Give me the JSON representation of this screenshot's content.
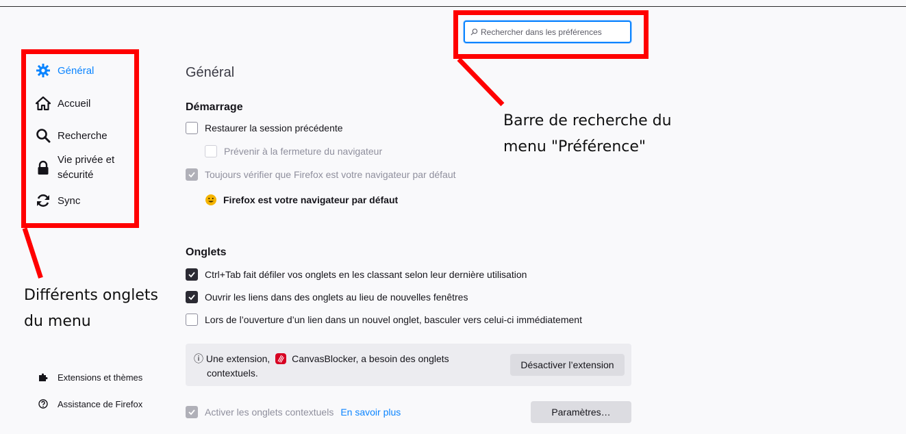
{
  "search": {
    "placeholder": "Rechercher dans les préférences"
  },
  "annotations": {
    "search_label_line1": "Barre de recherche du",
    "search_label_line2": "menu \"Préférence\"",
    "tabs_label_line1": "Différents onglets",
    "tabs_label_line2": "du menu",
    "color": "#ff0000"
  },
  "sidebar": {
    "items": [
      {
        "label": "Général",
        "icon": "gear-icon",
        "active": true
      },
      {
        "label": "Accueil",
        "icon": "home-icon"
      },
      {
        "label": "Recherche",
        "icon": "search-icon"
      },
      {
        "label_line1": "Vie privée et",
        "label_line2": "sécurité",
        "icon": "lock-icon"
      },
      {
        "label": "Sync",
        "icon": "sync-icon"
      }
    ],
    "footer": [
      {
        "label": "Extensions et thèmes",
        "icon": "puzzle-icon"
      },
      {
        "label": "Assistance de Firefox",
        "icon": "help-icon"
      }
    ]
  },
  "main": {
    "title": "Général",
    "startup": {
      "title": "Démarrage",
      "restore_session": "Restaurer la session précédente",
      "warn_on_close": "Prévenir à la fermeture du navigateur",
      "check_default": "Toujours vérifier que Firefox est votre navigateur par défaut",
      "default_status": "Firefox est votre navigateur par défaut"
    },
    "tabs": {
      "title": "Onglets",
      "ctrl_tab": "Ctrl+Tab fait défiler vos onglets en les classant selon leur dernière utilisation",
      "open_links": "Ouvrir les liens dans des onglets au lieu de nouvelles fenêtres",
      "switch_to_new": "Lors de l’ouverture d’un lien dans un nouvel onglet, basculer vers celui-ci immédiatement",
      "info_prefix": "ⓘ Une extension,",
      "info_ext_name": "CanvasBlocker, a besoin des onglets",
      "info_suffix": "contextuels.",
      "disable_ext_button": "Désactiver l’extension",
      "container_tabs": "Activer les onglets contextuels",
      "learn_more": "En savoir plus",
      "settings_button": "Paramètres…"
    }
  },
  "colors": {
    "accent": "#0a84ff",
    "annotation": "#ff0000"
  }
}
